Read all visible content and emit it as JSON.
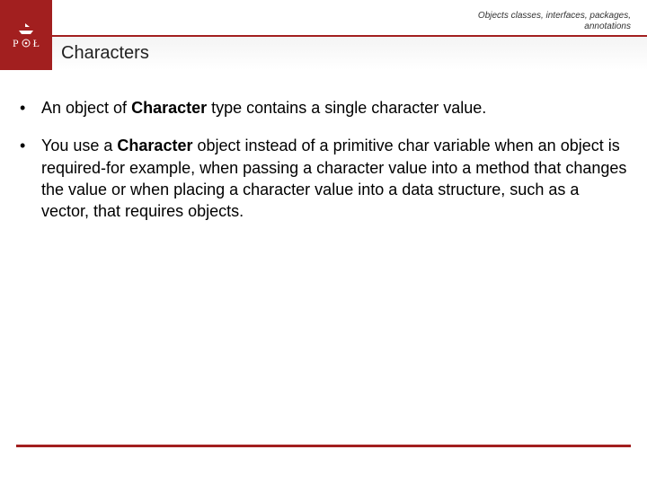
{
  "header": {
    "breadcrumb_line1": "Objects classes, interfaces, packages,",
    "breadcrumb_line2": "annotations",
    "logo_letter_left": "P",
    "logo_letter_right": "Ł"
  },
  "title": "Characters",
  "bullets": [
    {
      "pre": "An object of ",
      "bold": "Character",
      "post": " type contains a single character value."
    },
    {
      "pre": "You use a ",
      "bold": "Character",
      "post": " object instead of a primitive char variable when an object is required-for example, when passing a character value into a method that changes the value or when placing a character value into a data structure, such as a vector, that requires objects."
    }
  ],
  "colors": {
    "brand": "#a21f1f"
  }
}
